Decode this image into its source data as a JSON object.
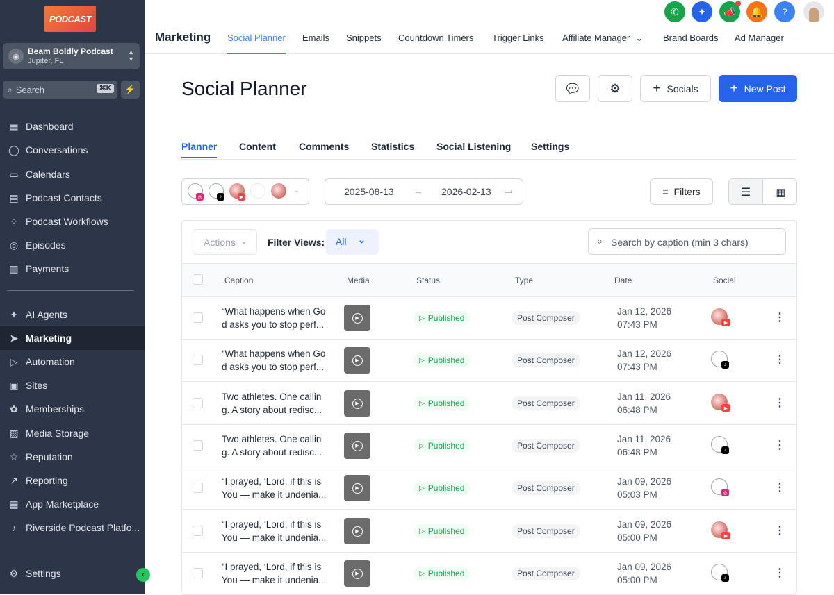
{
  "sidebar": {
    "logo_text": "PODCAST",
    "location": {
      "name": "Beam Boldly Podcast",
      "city": "Jupiter, FL"
    },
    "search": {
      "placeholder": "Search",
      "shortcut": "⌘K"
    },
    "items_top": [
      {
        "label": "Dashboard",
        "icon": "dashboard-icon"
      },
      {
        "label": "Conversations",
        "icon": "chat-icon"
      },
      {
        "label": "Calendars",
        "icon": "calendar-icon"
      },
      {
        "label": "Podcast Contacts",
        "icon": "contacts-icon"
      },
      {
        "label": "Podcast Workflows",
        "icon": "workflow-icon"
      },
      {
        "label": "Episodes",
        "icon": "podcast-icon"
      },
      {
        "label": "Payments",
        "icon": "receipt-icon"
      }
    ],
    "items_bottom": [
      {
        "label": "AI Agents",
        "icon": "sparkle-icon"
      },
      {
        "label": "Marketing",
        "icon": "send-icon",
        "active": true
      },
      {
        "label": "Automation",
        "icon": "play-circle-icon"
      },
      {
        "label": "Sites",
        "icon": "globe-icon"
      },
      {
        "label": "Memberships",
        "icon": "badge-icon"
      },
      {
        "label": "Media Storage",
        "icon": "image-icon"
      },
      {
        "label": "Reputation",
        "icon": "star-icon"
      },
      {
        "label": "Reporting",
        "icon": "chart-line-icon"
      },
      {
        "label": "App Marketplace",
        "icon": "grid-icon"
      },
      {
        "label": "Riverside Podcast Platfo...",
        "icon": "mic-icon"
      }
    ],
    "settings_label": "Settings"
  },
  "topbar": {
    "title": "Marketing",
    "tabs": [
      "Social Planner",
      "Emails",
      "Snippets",
      "Countdown Timers",
      "Trigger Links",
      "Affiliate Manager",
      "Brand Boards",
      "Ad Manager"
    ],
    "active_tab": "Social Planner",
    "icons": [
      {
        "name": "phone-icon",
        "color": "#16a34a"
      },
      {
        "name": "sparkle-icon",
        "color": "#2563eb"
      },
      {
        "name": "megaphone-icon",
        "color": "#16a34a"
      },
      {
        "name": "bell-icon",
        "color": "#f97316"
      },
      {
        "name": "help-icon",
        "color": "#3b82f6"
      }
    ]
  },
  "page": {
    "title": "Social Planner",
    "buttons": {
      "socials": "Socials",
      "new_post": "New Post"
    },
    "subtabs": [
      "Planner",
      "Content",
      "Comments",
      "Statistics",
      "Social Listening",
      "Settings"
    ],
    "active_subtab": "Planner",
    "date_from": "2025-08-13",
    "date_to": "2026-02-13",
    "filters_label": "Filters",
    "actions_label": "Actions",
    "filter_views_label": "Filter Views:",
    "filter_views_value": "All",
    "search_placeholder": "Search by caption (min 3 chars)"
  },
  "table": {
    "columns": [
      "Caption",
      "Media",
      "Status",
      "Type",
      "Date",
      "Social"
    ],
    "rows": [
      {
        "caption1": "“What happens when Go",
        "caption2": "d asks you to stop perf...",
        "status": "Published",
        "type": "Post Composer",
        "date": "Jan 12, 2026",
        "time": "07:43 PM",
        "social": "youtube"
      },
      {
        "caption1": "“What happens when Go",
        "caption2": "d asks you to stop perf...",
        "status": "Published",
        "type": "Post Composer",
        "date": "Jan 12, 2026",
        "time": "07:43 PM",
        "social": "tiktok"
      },
      {
        "caption1": "Two athletes. One callin",
        "caption2": "g. A story about redisc...",
        "status": "Published",
        "type": "Post Composer",
        "date": "Jan 11, 2026",
        "time": "06:48 PM",
        "social": "youtube"
      },
      {
        "caption1": "Two athletes. One callin",
        "caption2": "g. A story about redisc...",
        "status": "Published",
        "type": "Post Composer",
        "date": "Jan 11, 2026",
        "time": "06:48 PM",
        "social": "tiktok"
      },
      {
        "caption1": "“I prayed, ‘Lord, if this is",
        "caption2": "You — make it undenia...",
        "status": "Published",
        "type": "Post Composer",
        "date": "Jan 09, 2026",
        "time": "05:03 PM",
        "social": "instagram"
      },
      {
        "caption1": "“I prayed, ‘Lord, if this is",
        "caption2": "You — make it undenia...",
        "status": "Published",
        "type": "Post Composer",
        "date": "Jan 09, 2026",
        "time": "05:00 PM",
        "social": "youtube"
      },
      {
        "caption1": "“I prayed, ‘Lord, if this is",
        "caption2": "You — make it undenia...",
        "status": "Published",
        "type": "Post Composer",
        "date": "Jan 09, 2026",
        "time": "05:00 PM",
        "social": "tiktok"
      }
    ]
  }
}
